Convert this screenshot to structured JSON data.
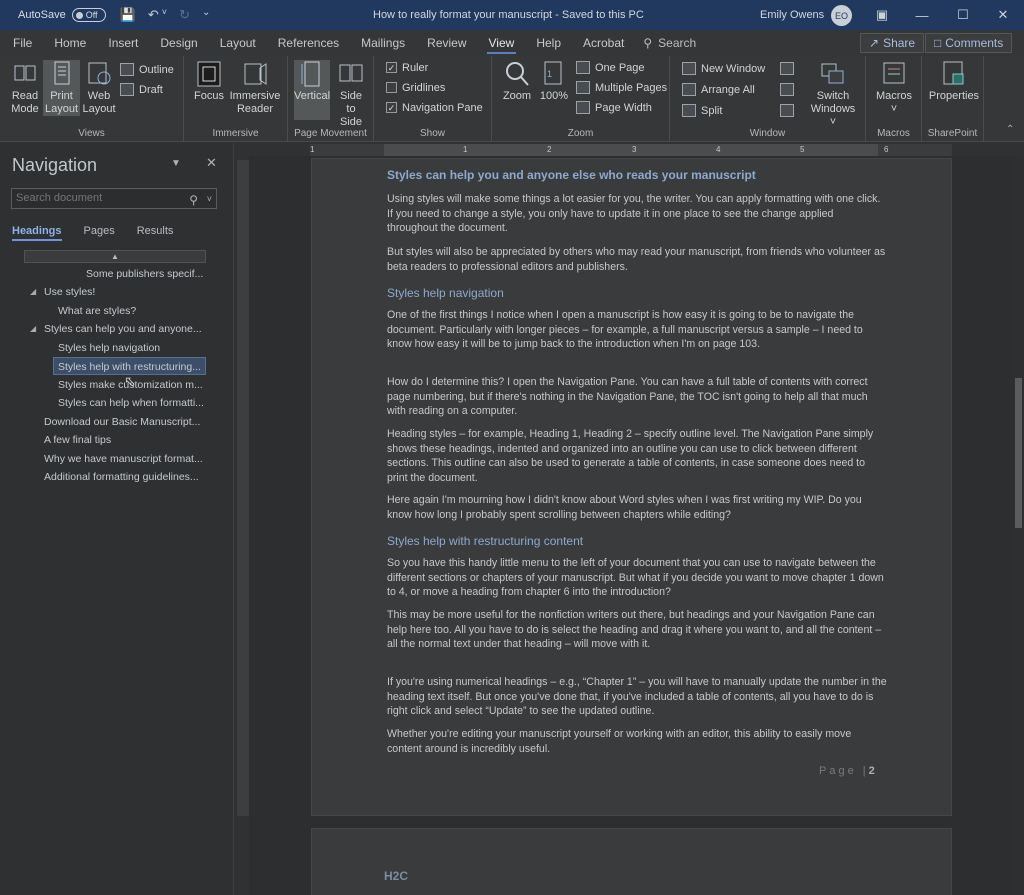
{
  "titlebar": {
    "autosave": "AutoSave",
    "toggle": "Off",
    "title": "How to really format your manuscript  -  Saved to this PC",
    "user": "Emily Owens",
    "initials": "EO"
  },
  "tabs": [
    "File",
    "Home",
    "Insert",
    "Design",
    "Layout",
    "References",
    "Mailings",
    "Review",
    "View",
    "Help",
    "Acrobat"
  ],
  "search_label": "Search",
  "share": "Share",
  "comments": "Comments",
  "ribbon": {
    "views": {
      "label": "Views",
      "read_mode": [
        "Read",
        "Mode"
      ],
      "print_layout": [
        "Print",
        "Layout"
      ],
      "web_layout": [
        "Web",
        "Layout"
      ],
      "outline": "Outline",
      "draft": "Draft"
    },
    "immersive": {
      "label": "Immersive",
      "focus": "Focus",
      "immersive_reader": [
        "Immersive",
        "Reader"
      ]
    },
    "page_movement": {
      "label": "Page Movement",
      "vertical": "Vertical",
      "side": [
        "Side",
        "to Side"
      ]
    },
    "show": {
      "label": "Show",
      "ruler": "Ruler",
      "gridlines": "Gridlines",
      "navpane": "Navigation Pane"
    },
    "zoom": {
      "label": "Zoom",
      "zoom": "Zoom",
      "pct": "100%",
      "one_page": "One Page",
      "multiple": "Multiple Pages",
      "page_width": "Page Width"
    },
    "window": {
      "label": "Window",
      "new_window": "New Window",
      "arrange_all": "Arrange All",
      "split": "Split",
      "switch": [
        "Switch",
        "Windows ˅"
      ]
    },
    "macros": {
      "label": "Macros",
      "macros": "Macros"
    },
    "sharepoint": {
      "label": "SharePoint",
      "properties": "Properties"
    }
  },
  "nav": {
    "title": "Navigation",
    "search_placeholder": "Search document",
    "tabs": [
      "Headings",
      "Pages",
      "Results"
    ],
    "items": [
      "Some publishers specif...",
      "Use styles!",
      "What are styles?",
      "Styles can help you and anyone...",
      "Styles help navigation",
      "Styles help with restructuring...",
      "Styles make customization m...",
      "Styles can help when formatti...",
      "Download our Basic Manuscript...",
      "A few final tips",
      "Why we have manuscript format...",
      "Additional formatting guidelines..."
    ]
  },
  "ruler_nums": [
    "1",
    "1",
    "2",
    "3",
    "4",
    "5",
    "6"
  ],
  "doc": {
    "h1": "Styles can help you and anyone else who reads your manuscript",
    "p1": "Using styles will make some things a lot easier for you, the writer. You can apply formatting with one click. If you need to change a style, you only have to update it in one place to see the change applied throughout the document.",
    "p2": "But styles will also be appreciated by others who may read your manuscript, from friends who volunteer as beta readers to professional editors and publishers.",
    "h2": "Styles help navigation",
    "p3": "One of the first things I notice when I open a manuscript is how easy it is going to be to navigate the document. Particularly with longer pieces – for example, a full manuscript versus a sample – I need to know how easy it will be to jump back to the introduction when I'm on page 103.",
    "p4": "How do I determine this? I open the Navigation Pane. You can have a full table of contents with correct page numbering, but if there's nothing in the Navigation Pane, the TOC isn't going to help all that much with reading on a computer.",
    "p5": "Heading styles – for example, Heading 1, Heading 2 – specify outline level. The Navigation Pane simply shows these headings, indented and organized into an outline you can use to click between different sections. This outline can also be used to generate a table of contents, in case someone does need to print the document.",
    "p6": "Here again I'm mourning how I didn't know about Word styles when I was first writing my WIP. Do you know how long I probably spent scrolling between chapters while editing?",
    "h3": "Styles help with restructuring content",
    "p7": "So you have this handy little menu to the left of your document that you can use to navigate between the different sections or chapters of your manuscript. But what if you decide you want to move chapter 1 down to 4, or move a heading from chapter 6 into the introduction?",
    "p8": "This may be more useful for the nonfiction writers out there, but headings and your Navigation Pane can help here too. All you have to do is select the heading and drag it where you want to, and all the content – all the normal text under that heading – will move with it.",
    "p9": "If you're using numerical headings – e.g., “Chapter 1” – you will have to manually update the number in the heading text itself. But once you've done that, if you've included a table of contents, all you have to do is right click and select “Update” to see the updated outline.",
    "p10": "Whether you're editing your manuscript yourself or working with an editor, this ability to easily move content around is incredibly useful.",
    "page_label": "Page |",
    "page_num": "2",
    "logo": "H2C"
  }
}
